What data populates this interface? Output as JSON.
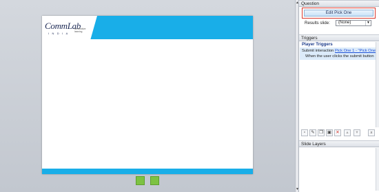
{
  "slide": {
    "logo_text": "CommLab",
    "logo_sub": "INDIA",
    "logo_tagline": "for effective learning"
  },
  "panel": {
    "question_header": "Question",
    "edit_button_label": "Edit Pick One",
    "results_label": "Results slide:",
    "results_value": "(None)",
    "triggers_header": "Triggers",
    "trigger_group": "Player Triggers",
    "trigger_prefix": "Submit interaction ",
    "trigger_link": "Pick One 1 - \"Pick One\"",
    "trigger_condition": "When the user clicks the submit button",
    "slide_layers_header": "Slide Layers"
  },
  "toolbar_icons": [
    "new-trigger-icon",
    "edit-trigger-icon",
    "copy-icon",
    "paste-icon",
    "delete-icon",
    "move-up-icon",
    "move-down-icon",
    "variables-icon"
  ],
  "colors": {
    "accent": "#19aee8",
    "thumbnail": "#7dc242",
    "highlight": "#d9382d"
  }
}
